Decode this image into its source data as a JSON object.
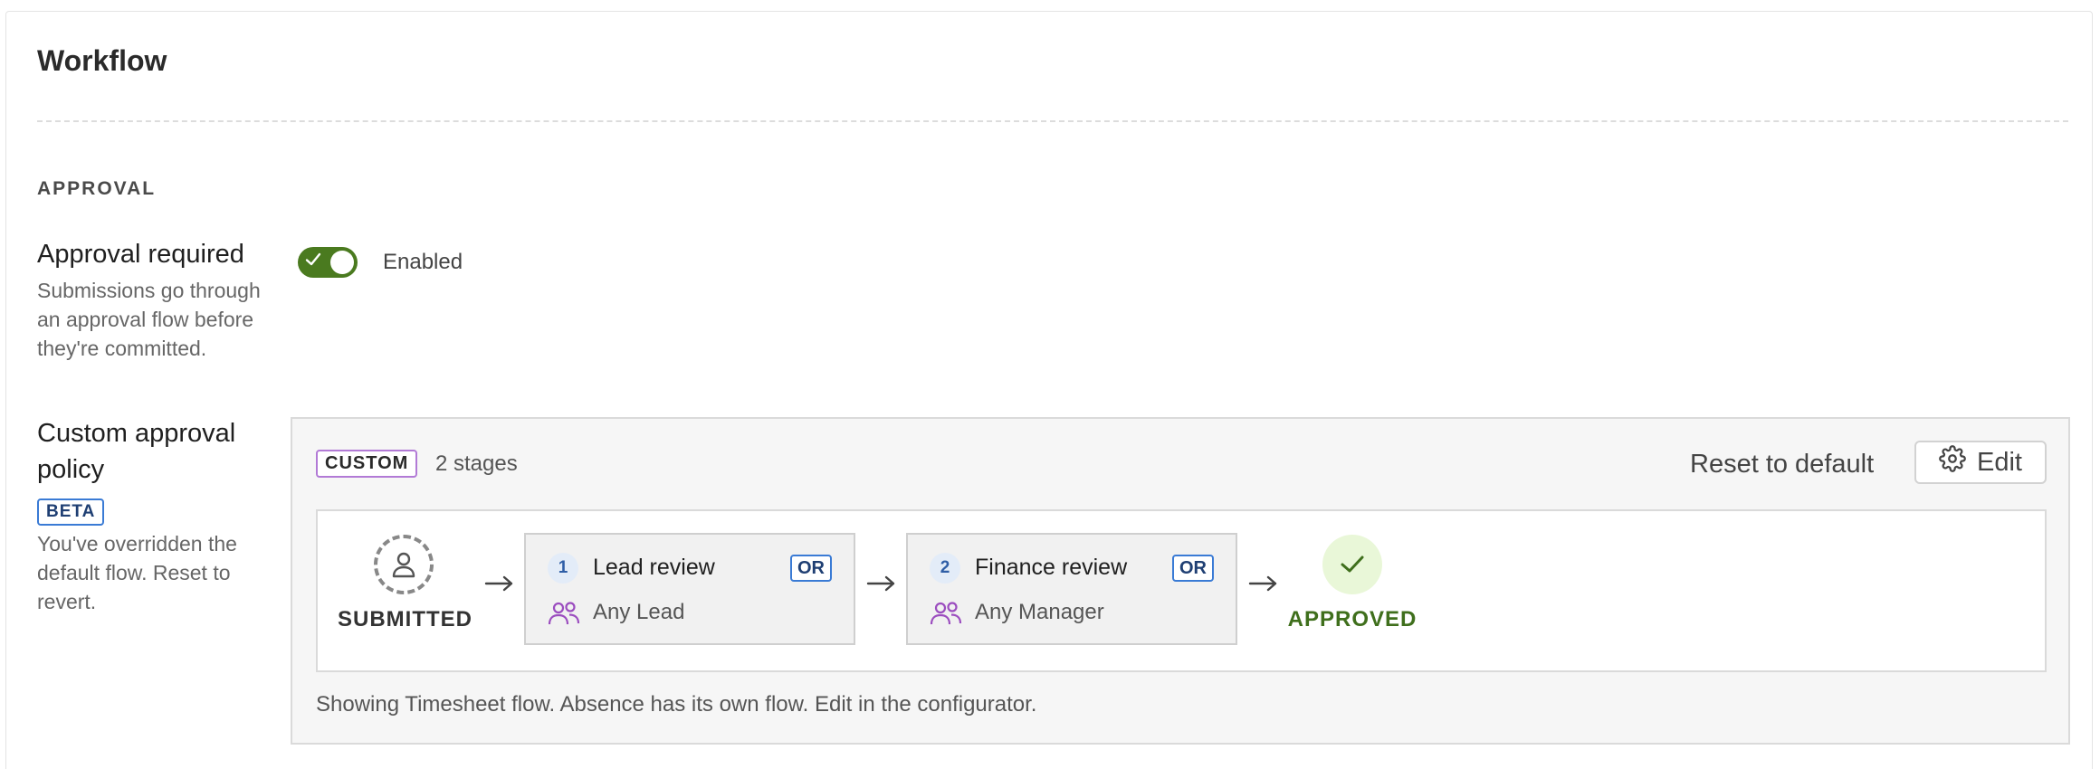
{
  "card": {
    "title": "Workflow"
  },
  "section": {
    "label": "APPROVAL"
  },
  "approval": {
    "title": "Approval required",
    "description": "Submissions go through an approval flow before they're committed.",
    "toggle_state": "Enabled",
    "enabled": true
  },
  "policy": {
    "title": "Custom approval policy",
    "beta_badge": "BETA",
    "description": "You've overridden the default flow. Reset to revert.",
    "panel": {
      "custom_badge": "CUSTOM",
      "stages_count": "2 stages",
      "reset_label": "Reset to default",
      "edit_label": "Edit",
      "note": "Showing Timesheet flow. Absence has its own flow. Edit in the configurator."
    },
    "flow": {
      "start_label": "SUBMITTED",
      "end_label": "APPROVED",
      "stages": [
        {
          "number": "1",
          "name": "Lead review",
          "mode": "OR",
          "approver": "Any Lead"
        },
        {
          "number": "2",
          "name": "Finance review",
          "mode": "OR",
          "approver": "Any Manager"
        }
      ]
    }
  },
  "colors": {
    "toggle_on": "#4a7a1f",
    "approved_text": "#3f6f1c",
    "approved_bg": "#e9f7d8",
    "badge_blue": "#3a7bd5",
    "custom_badge_border": "#b27ad6",
    "group_icon": "#9b4dbf"
  },
  "icons": {
    "toggle_check": "check-icon",
    "submitted": "person-icon",
    "edit": "gear-icon",
    "approver": "people-group-icon",
    "approved": "check-icon",
    "arrow": "arrow-right-icon"
  }
}
